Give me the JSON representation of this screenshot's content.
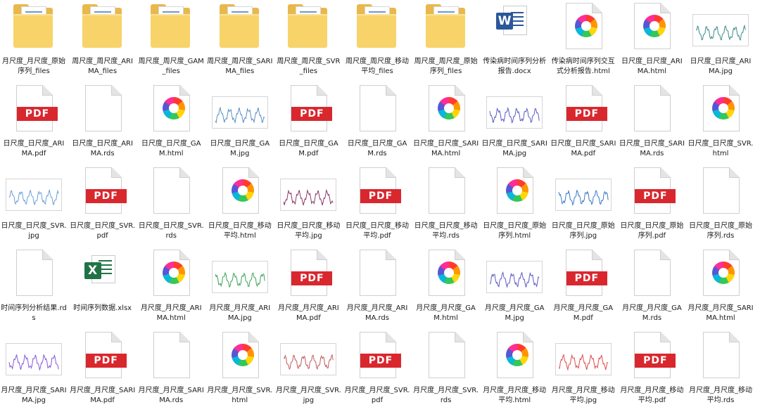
{
  "files": [
    {
      "name": "月尺度_月尺度_原始序列_files",
      "type": "folder"
    },
    {
      "name": "周尺度_周尺度_ARIMA_files",
      "type": "folder"
    },
    {
      "name": "周尺度_周尺度_GAM_files",
      "type": "folder"
    },
    {
      "name": "周尺度_周尺度_SARIMA_files",
      "type": "folder"
    },
    {
      "name": "周尺度_周尺度_SVR_files",
      "type": "folder"
    },
    {
      "name": "周尺度_周尺度_移动平均_files",
      "type": "folder"
    },
    {
      "name": "周尺度_周尺度_原始序列_files",
      "type": "folder"
    },
    {
      "name": "传染病时间序列分析报告.docx",
      "type": "docx"
    },
    {
      "name": "传染病时间序列交互式分析报告.html",
      "type": "html"
    },
    {
      "name": "日尺度_日尺度_ARIMA.html",
      "type": "html"
    },
    {
      "name": "日尺度_日尺度_ARIMA.jpg",
      "type": "jpg",
      "accent": "#3a8a8a"
    },
    {
      "name": "日尺度_日尺度_ARIMA.pdf",
      "type": "pdf"
    },
    {
      "name": "日尺度_日尺度_ARIMA.rds",
      "type": "rds"
    },
    {
      "name": "日尺度_日尺度_GAM.html",
      "type": "html"
    },
    {
      "name": "日尺度_日尺度_GAM.jpg",
      "type": "jpg",
      "accent": "#5a8fc4"
    },
    {
      "name": "日尺度_日尺度_GAM.pdf",
      "type": "pdf"
    },
    {
      "name": "日尺度_日尺度_GAM.rds",
      "type": "rds"
    },
    {
      "name": "日尺度_日尺度_SARIMA.html",
      "type": "html"
    },
    {
      "name": "日尺度_日尺度_SARIMA.jpg",
      "type": "jpg",
      "accent": "#5a5ac4"
    },
    {
      "name": "日尺度_日尺度_SARIMA.pdf",
      "type": "pdf"
    },
    {
      "name": "日尺度_日尺度_SARIMA.rds",
      "type": "rds"
    },
    {
      "name": "日尺度_日尺度_SVR.html",
      "type": "html"
    },
    {
      "name": "日尺度_日尺度_SVR.jpg",
      "type": "jpg",
      "accent": "#6a9fd4"
    },
    {
      "name": "日尺度_日尺度_SVR.pdf",
      "type": "pdf"
    },
    {
      "name": "日尺度_日尺度_SVR.rds",
      "type": "rds"
    },
    {
      "name": "日尺度_日尺度_移动平均.html",
      "type": "html"
    },
    {
      "name": "日尺度_日尺度_移动平均.jpg",
      "type": "jpg",
      "accent": "#8a3a6a"
    },
    {
      "name": "日尺度_日尺度_移动平均.pdf",
      "type": "pdf"
    },
    {
      "name": "日尺度_日尺度_移动平均.rds",
      "type": "rds"
    },
    {
      "name": "日尺度_日尺度_原始序列.html",
      "type": "html"
    },
    {
      "name": "日尺度_日尺度_原始序列.jpg",
      "type": "jpg",
      "accent": "#3a7ac4"
    },
    {
      "name": "日尺度_日尺度_原始序列.pdf",
      "type": "pdf"
    },
    {
      "name": "日尺度_日尺度_原始序列.rds",
      "type": "rds"
    },
    {
      "name": "时间序列分析结果.rds",
      "type": "rds"
    },
    {
      "name": "时间序列数据.xlsx",
      "type": "xlsx"
    },
    {
      "name": "月尺度_月尺度_ARIMA.html",
      "type": "html"
    },
    {
      "name": "月尺度_月尺度_ARIMA.jpg",
      "type": "jpg",
      "accent": "#3aa05a"
    },
    {
      "name": "月尺度_月尺度_ARIMA.pdf",
      "type": "pdf"
    },
    {
      "name": "月尺度_月尺度_ARIMA.rds",
      "type": "rds"
    },
    {
      "name": "月尺度_月尺度_GAM.html",
      "type": "html"
    },
    {
      "name": "月尺度_月尺度_GAM.jpg",
      "type": "jpg",
      "accent": "#5a5ac4"
    },
    {
      "name": "月尺度_月尺度_GAM.pdf",
      "type": "pdf"
    },
    {
      "name": "月尺度_月尺度_GAM.rds",
      "type": "rds"
    },
    {
      "name": "月尺度_月尺度_SARIMA.html",
      "type": "html"
    },
    {
      "name": "月尺度_月尺度_SARIMA.jpg",
      "type": "jpg",
      "accent": "#8a5ad4"
    },
    {
      "name": "月尺度_月尺度_SARIMA.pdf",
      "type": "pdf"
    },
    {
      "name": "月尺度_月尺度_SARIMA.rds",
      "type": "rds"
    },
    {
      "name": "月尺度_月尺度_SVR.html",
      "type": "html"
    },
    {
      "name": "月尺度_月尺度_SVR.jpg",
      "type": "jpg",
      "accent": "#c05a5a"
    },
    {
      "name": "月尺度_月尺度_SVR.pdf",
      "type": "pdf"
    },
    {
      "name": "月尺度_月尺度_SVR.rds",
      "type": "rds"
    },
    {
      "name": "月尺度_月尺度_移动平均.html",
      "type": "html"
    },
    {
      "name": "月尺度_月尺度_移动平均.jpg",
      "type": "jpg",
      "accent": "#e04a4a"
    },
    {
      "name": "月尺度_月尺度_移动平均.pdf",
      "type": "pdf"
    },
    {
      "name": "月尺度_月尺度_移动平均.rds",
      "type": "rds"
    }
  ],
  "pdf_label": "PDF",
  "word_glyph": "W",
  "excel_glyph": "X"
}
